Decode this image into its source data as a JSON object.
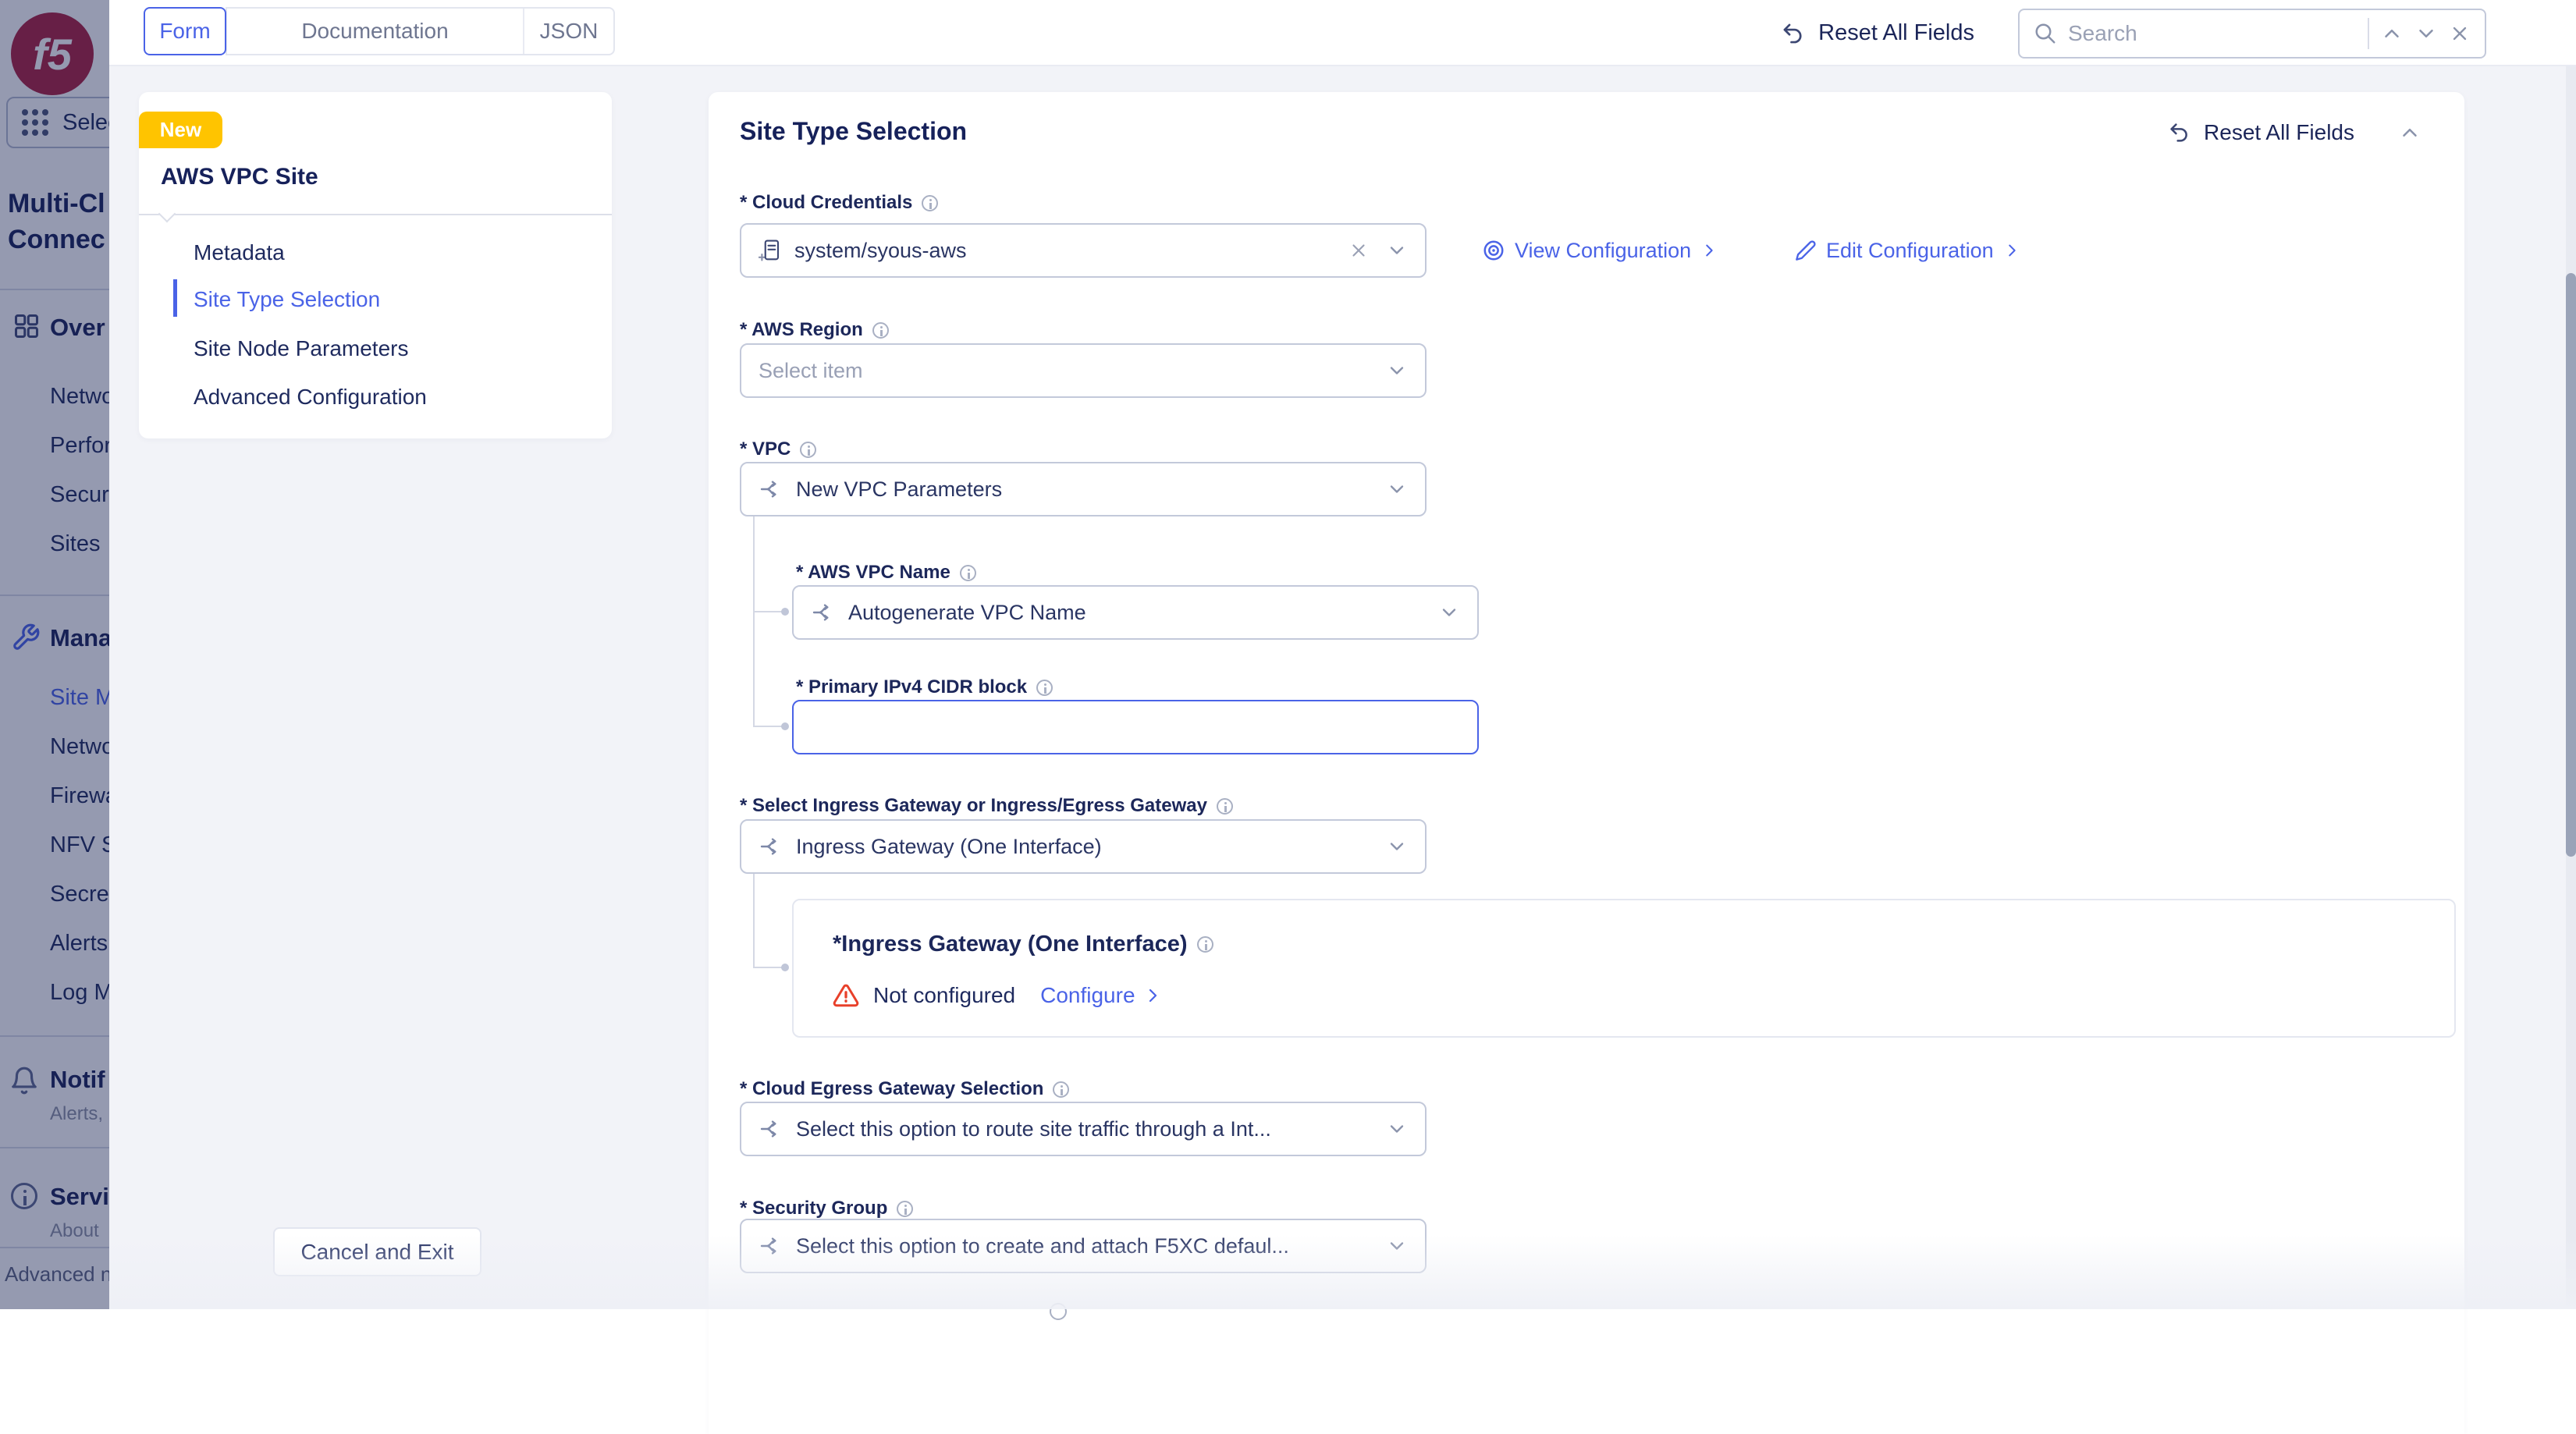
{
  "topbar": {
    "tabs": [
      "Form",
      "Documentation",
      "JSON"
    ],
    "reset_label": "Reset All Fields",
    "search_placeholder": "Search"
  },
  "sidebar": {
    "select_label": "Selec",
    "title_lines": [
      "Multi-Cl",
      "Connec"
    ],
    "groups": [
      {
        "icon": "grid-squares",
        "label": "Over",
        "items": [
          "Netwo",
          "Perfor",
          "Secur",
          "Sites"
        ]
      },
      {
        "icon": "wrench",
        "label": "Mana",
        "items": [
          "Site M",
          "Netwo",
          "Firewa",
          "NFV S",
          "Secre",
          "Alerts",
          "Log M"
        ],
        "active_item_index": 0
      }
    ],
    "notifications": {
      "icon": "bell",
      "label": "Notif",
      "sub": "Alerts,"
    },
    "service": {
      "icon": "info-circle",
      "label": "Servi",
      "sub": "About"
    },
    "advanced_label": "Advanced n"
  },
  "panel_nav": {
    "badge": "New",
    "title": "AWS VPC Site",
    "items": [
      "Metadata",
      "Site Type Selection",
      "Site Node Parameters",
      "Advanced Configuration"
    ],
    "active_index": 1,
    "cancel_label": "Cancel and Exit"
  },
  "form": {
    "title": "Site Type Selection",
    "reset_label": "Reset All Fields",
    "links": {
      "view": "View Configuration",
      "edit": "Edit Configuration"
    },
    "fields": {
      "cloud_credentials": {
        "label": "* Cloud Credentials",
        "value": "system/syous-aws"
      },
      "aws_region": {
        "label": "* AWS Region",
        "placeholder": "Select item"
      },
      "vpc": {
        "label": "* VPC",
        "value": "New VPC Parameters"
      },
      "aws_vpc_name": {
        "label": "* AWS VPC Name",
        "value": "Autogenerate VPC Name"
      },
      "cidr": {
        "label": "* Primary IPv4 CIDR block",
        "value": ""
      },
      "ingress_select": {
        "label": "* Select Ingress Gateway or Ingress/Egress Gateway",
        "value": "Ingress Gateway (One Interface)"
      },
      "egress": {
        "label": "* Cloud Egress Gateway Selection",
        "value": "Select this option to route site traffic through a Int..."
      },
      "security_group": {
        "label": "* Security Group",
        "value": "Select this option to create and attach F5XC defaul..."
      }
    },
    "ingress_card": {
      "title": "*Ingress Gateway (One Interface)",
      "status": "Not configured",
      "action": "Configure"
    }
  },
  "colors": {
    "accent_blue": "#4a63e7",
    "navy_text": "#1c275a",
    "badge_yellow": "#ffc400",
    "warning_red": "#e8402a",
    "brand_red": "#ab1f3f",
    "border_gray": "#c3c9da",
    "background_gray": "#f2f3f8"
  },
  "icons": {
    "reset": "undo-curved-arrow",
    "search": "magnifying-glass",
    "search_prev": "chevron-up",
    "search_next": "chevron-down",
    "search_close": "x-mark",
    "dropdown": "chevron-down",
    "clear": "x-mark",
    "field_type": "branch-arrows",
    "credentials": "document-plus",
    "view": "eye",
    "edit": "pencil",
    "status_warning": "alert-triangle",
    "link_arrow": "chevron-right",
    "collapse": "chevron-up",
    "apps": "dots-grid",
    "overview": "grid-squares",
    "manage": "wrench",
    "notifications": "bell",
    "service_info": "info-circle",
    "brand": "f5-logo"
  }
}
